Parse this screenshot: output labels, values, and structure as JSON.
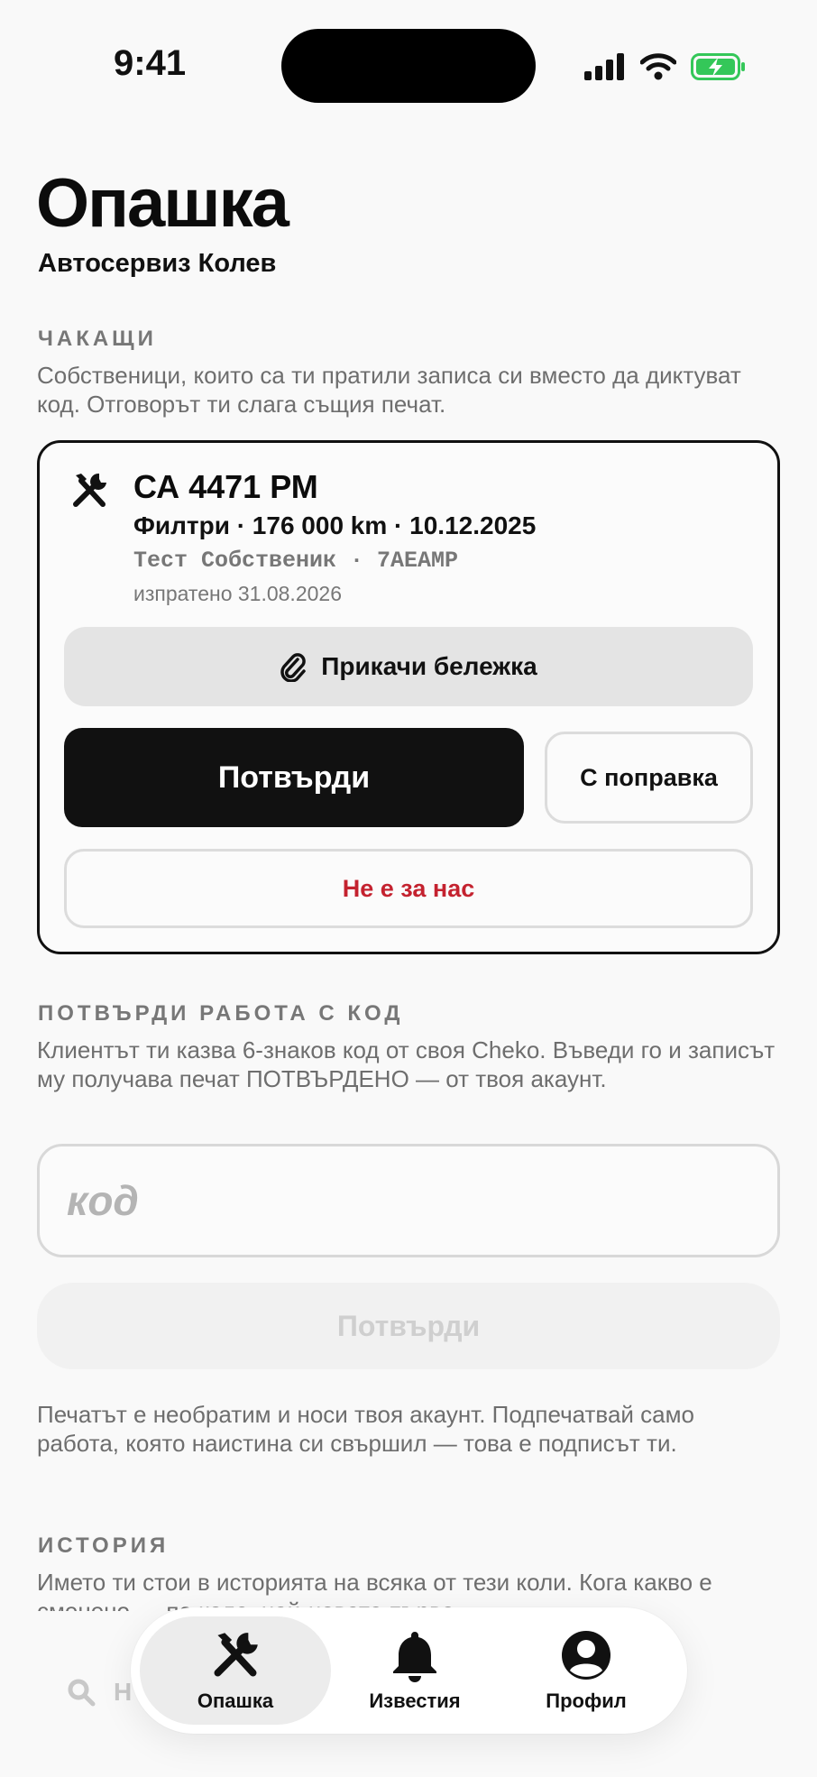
{
  "status_bar": {
    "time": "9:41"
  },
  "header": {
    "title": "Опашка",
    "subtitle": "Автосервиз Колев"
  },
  "waiting": {
    "label": "ЧАКАЩИ",
    "description": "Собственици, които са ти пратили записа си вместо да диктуват код. Отговорът ти слага същия печат.",
    "card": {
      "icon": "wrench-screwdriver-icon",
      "plate": "СА 4471 РМ",
      "details": "Филтри · 176 000 km · 10.12.2025",
      "owner": "Тест Собственик · 7AEAMP",
      "sent": "изпратено 31.08.2026",
      "attach_note_label": "Прикачи бележка",
      "confirm_label": "Потвърди",
      "with_fix_label": "С поправка",
      "reject_label": "Не е за нас"
    }
  },
  "code_section": {
    "label": "ПОТВЪРДИ РАБОТА С КОД",
    "description": "Клиентът ти казва 6-знаков код от своя Cheko. Въведи го и записът му получава печат ПОТВЪРДЕНО — от твоя акаунт.",
    "input_placeholder": "код",
    "confirm_label": "Потвърди",
    "footnote": "Печатът е необратим и носи твоя акаунт. Подпечатвай само работа, която наистина си свършил — това е подписът ти."
  },
  "history": {
    "label": "ИСТОРИЯ",
    "description": "Името ти стои в историята на всяка от тези коли. Кога какво е сменено — по коле, най-новата първа.",
    "search_placeholder": "Н"
  },
  "tab_bar": {
    "tabs": [
      {
        "label": "Опашка",
        "icon": "wrench-screwdriver-icon",
        "active": true
      },
      {
        "label": "Известия",
        "icon": "bell-icon",
        "active": false
      },
      {
        "label": "Профил",
        "icon": "person-circle-icon",
        "active": false
      }
    ]
  },
  "colors": {
    "background": "#f9f9f9",
    "primary": "#111111",
    "danger": "#c4222f",
    "muted": "#6e6e6e",
    "battery": "#34c759"
  }
}
